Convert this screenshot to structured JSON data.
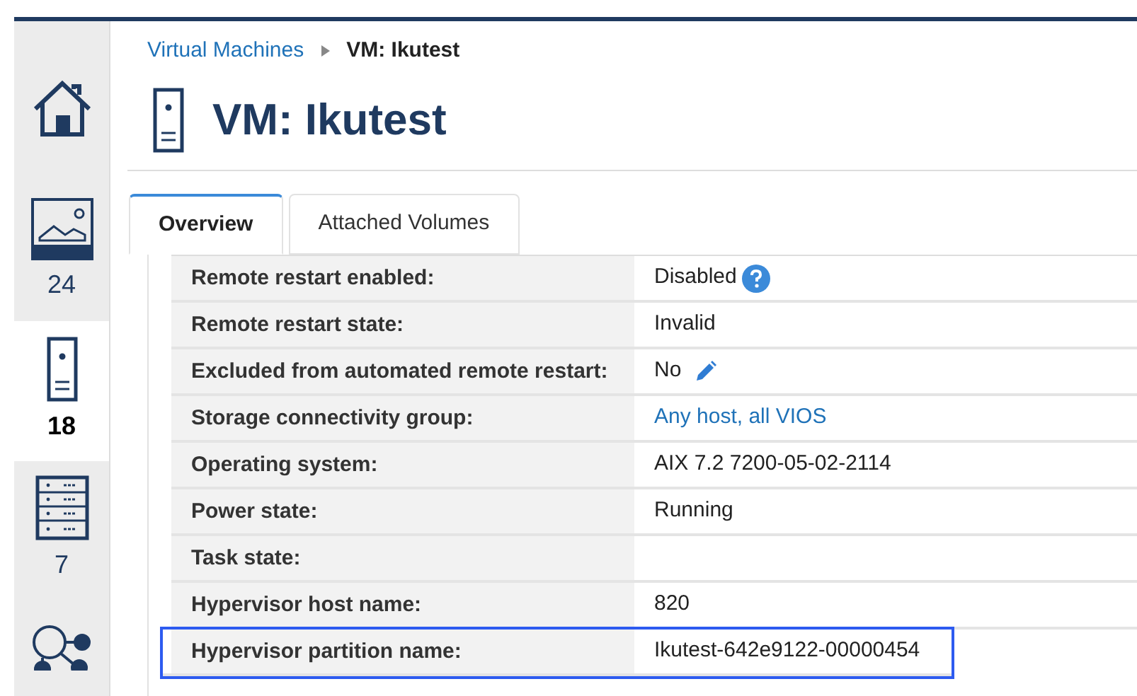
{
  "sidebar": {
    "items": [
      {
        "kind": "home",
        "selected": false
      },
      {
        "kind": "image",
        "count": "24",
        "selected": false
      },
      {
        "kind": "server",
        "count": "18",
        "selected": true
      },
      {
        "kind": "rack",
        "count": "7",
        "selected": false
      },
      {
        "kind": "network",
        "selected": false
      }
    ]
  },
  "breadcrumb": {
    "link": "Virtual Machines",
    "current": "VM: Ikutest"
  },
  "title": "VM: Ikutest",
  "tabs": [
    {
      "label": "Overview",
      "selected": true
    },
    {
      "label": "Attached Volumes",
      "selected": false
    }
  ],
  "properties": [
    {
      "label": "Remote restart enabled:",
      "value": "Disabled",
      "kind": "help",
      "highlighted": false
    },
    {
      "label": "Remote restart state:",
      "value": "Invalid",
      "kind": "text",
      "highlighted": false
    },
    {
      "label": "Excluded from automated remote restart:",
      "value": "No",
      "kind": "edit",
      "highlighted": false
    },
    {
      "label": "Storage connectivity group:",
      "value": "Any host, all VIOS",
      "kind": "link",
      "highlighted": false
    },
    {
      "label": "Operating system:",
      "value": "AIX 7.2 7200-05-02-2114",
      "kind": "text",
      "highlighted": false
    },
    {
      "label": "Power state:",
      "value": "Running",
      "kind": "text",
      "highlighted": false
    },
    {
      "label": "Task state:",
      "kind": "text",
      "highlighted": false
    },
    {
      "label": "Hypervisor host name:",
      "value": "820",
      "kind": "text",
      "highlighted": false
    },
    {
      "label": "Hypervisor partition name:",
      "value": "Ikutest-642e9122-00000454",
      "kind": "text",
      "highlighted": true
    }
  ]
}
